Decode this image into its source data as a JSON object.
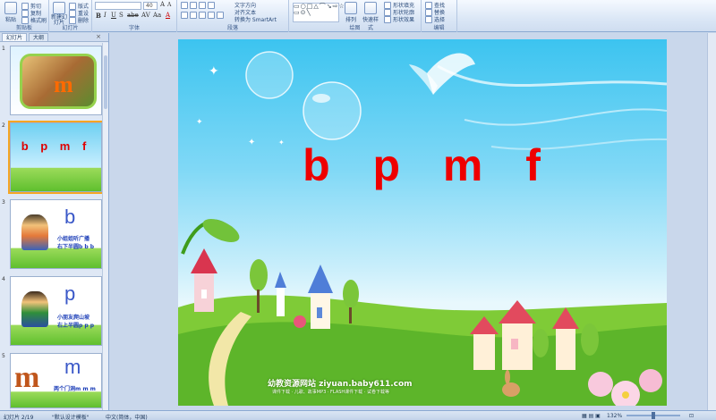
{
  "ribbon": {
    "groups": [
      {
        "label": "剪贴板"
      },
      {
        "label": "幻灯片"
      },
      {
        "label": "字体"
      },
      {
        "label": "段落"
      },
      {
        "label": "绘图"
      },
      {
        "label": "编辑"
      }
    ],
    "clipboard": {
      "paste": "粘贴",
      "cut": "剪切",
      "copy": "复制",
      "format_painter": "格式刷"
    },
    "slides": {
      "new_slide": "新建幻灯片",
      "layout": "版式",
      "reset": "重设",
      "delete": "删除"
    },
    "font": {
      "size_value": "40"
    },
    "paragraph": {
      "text_direction": "文字方向",
      "align_text": "对齐文本",
      "convert_smartart": "转换为 SmartArt"
    },
    "drawing": {
      "arrange": "排列",
      "quick_styles": "快速样式",
      "shape_fill": "形状填充",
      "shape_outline": "形状轮廓",
      "shape_effects": "形状效果"
    },
    "editing": {
      "find": "查找",
      "replace": "替换",
      "select": "选择"
    }
  },
  "left_panel": {
    "tabs": [
      "幻灯片",
      "大纲"
    ],
    "close_symbol": "×",
    "thumbnails": [
      {
        "number": "1",
        "letter": "m"
      },
      {
        "number": "2",
        "letters": "b p m f"
      },
      {
        "number": "3",
        "letter": "b",
        "line1": "小姐姐听广播",
        "line2": "右下半圆b b b"
      },
      {
        "number": "4",
        "letter": "p",
        "line1": "小朋友爬山坡",
        "line2": "右上半圆p p p"
      },
      {
        "number": "5",
        "letter": "m",
        "line1": "两个门洞m m m"
      }
    ]
  },
  "slide": {
    "letters": "b p m f",
    "site_text": "幼教资源网站  ziyuan.baby611.com",
    "sub_text": "课件下载 · 儿歌、故事MP3 · FLASH课件下载 · 试卷下载等"
  },
  "status": {
    "slide_position": "幻灯片 2/19",
    "theme": "\"默认设计模板\"",
    "language": "中文(简体，中国)",
    "zoom": "132%"
  },
  "colors": {
    "title_red": "#ee0000",
    "ribbon_blue": "#dbe7f6",
    "thumbnail_selected": "#f5a623"
  }
}
